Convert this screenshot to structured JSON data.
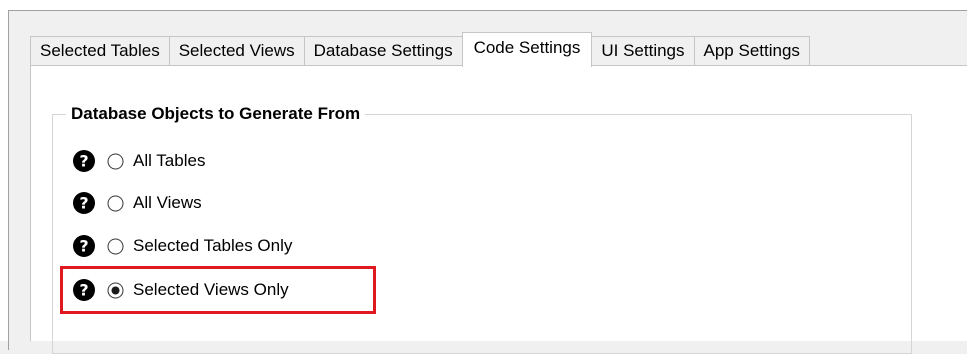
{
  "tabs": [
    {
      "label": "Selected Tables",
      "active": false
    },
    {
      "label": "Selected Views",
      "active": false
    },
    {
      "label": "Database Settings",
      "active": false
    },
    {
      "label": "Code Settings",
      "active": true
    },
    {
      "label": "UI Settings",
      "active": false
    },
    {
      "label": "App Settings",
      "active": false
    }
  ],
  "group": {
    "title": "Database Objects to Generate From",
    "options": [
      {
        "label": "All Tables",
        "selected": false,
        "icon": "help-icon"
      },
      {
        "label": "All Views",
        "selected": false,
        "icon": "help-icon"
      },
      {
        "label": "Selected Tables Only",
        "selected": false,
        "icon": "help-icon"
      },
      {
        "label": "Selected Views Only",
        "selected": true,
        "icon": "help-icon"
      }
    ]
  },
  "colors": {
    "highlight": "#e0181f",
    "panel_bg": "#ffffff",
    "window_bg": "#f0f0f0"
  }
}
